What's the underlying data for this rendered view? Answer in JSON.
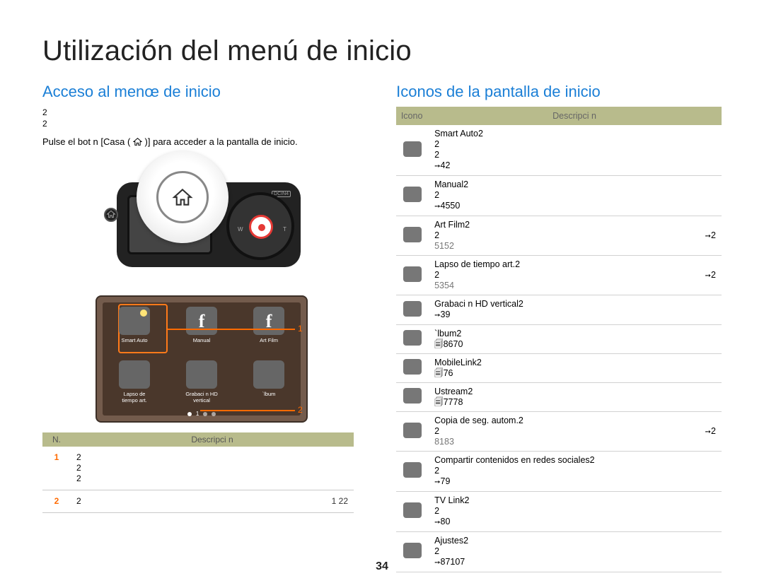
{
  "page": {
    "title": "Utilización del menú de inicio",
    "number": "34"
  },
  "left": {
    "heading": "Acceso al menœ de inicio",
    "intro1": "2",
    "intro2": "2",
    "instruction_pre": "Pulse el bot n [Casa (",
    "instruction_post": ")] para acceder a la pantalla de inicio.",
    "camera": {
      "dc": "DCIN4",
      "w": "W",
      "t": "T"
    },
    "grid": {
      "item1": "Smart Auto",
      "item2": "Manual",
      "item3": "Art Film",
      "item4a": "Lapso de",
      "item4b": "tiempo art.",
      "item5a": "Grabaci n HD",
      "item5b": "vertical",
      "item6": "`lbum",
      "dot": "1",
      "callout1": "1",
      "callout2": "2"
    },
    "table": {
      "head_no": "N.",
      "head_desc": "Descripci n",
      "r1_no": "1",
      "r1_l1": "2",
      "r1_l2": "2",
      "r1_l3": "2",
      "r2_no": "2",
      "r2_desc": "2",
      "r2_pages": "1  22"
    }
  },
  "right": {
    "heading": "Iconos de la pantalla de inicio",
    "table": {
      "head_icon": "Icono",
      "head_desc": "Descripci n"
    },
    "rows": [
      {
        "title": "Smart Auto2",
        "l2": "2",
        "l3": "2",
        "arrow": true,
        "pg": "42"
      },
      {
        "title": "Manual2",
        "l2": "2",
        "arrow": true,
        "pg": "4550"
      },
      {
        "title": "Art Film2",
        "l2": "2",
        "arrow": true,
        "arrow_far": true,
        "pg": "2",
        "extra": "5152"
      },
      {
        "title": "Lapso de tiempo art.2",
        "l2": "2",
        "arrow": true,
        "arrow_far": true,
        "pg": "2",
        "extra": "5354"
      },
      {
        "title": "Grabaci n HD vertical2",
        "arrow": true,
        "pg": "39"
      },
      {
        "title": "`lbum2",
        "pages_glyph": true,
        "pg": "8670"
      },
      {
        "title": "MobileLink2",
        "pages_glyph": true,
        "pg": "76"
      },
      {
        "title": "Ustream2",
        "pages_glyph": true,
        "pg": "7778"
      },
      {
        "title": "Copia de seg. autom.2",
        "l2": "2",
        "arrow": true,
        "arrow_far": true,
        "pg": "2",
        "extra": "8183"
      },
      {
        "title": "Compartir contenidos en redes sociales2",
        "l2": "2",
        "arrow": true,
        "pg": "79"
      },
      {
        "title": "TV Link2",
        "l2": "2",
        "arrow": true,
        "pg": "80"
      },
      {
        "title": "Ajustes2",
        "l2": "2",
        "arrow": true,
        "pg": "87107"
      }
    ]
  }
}
